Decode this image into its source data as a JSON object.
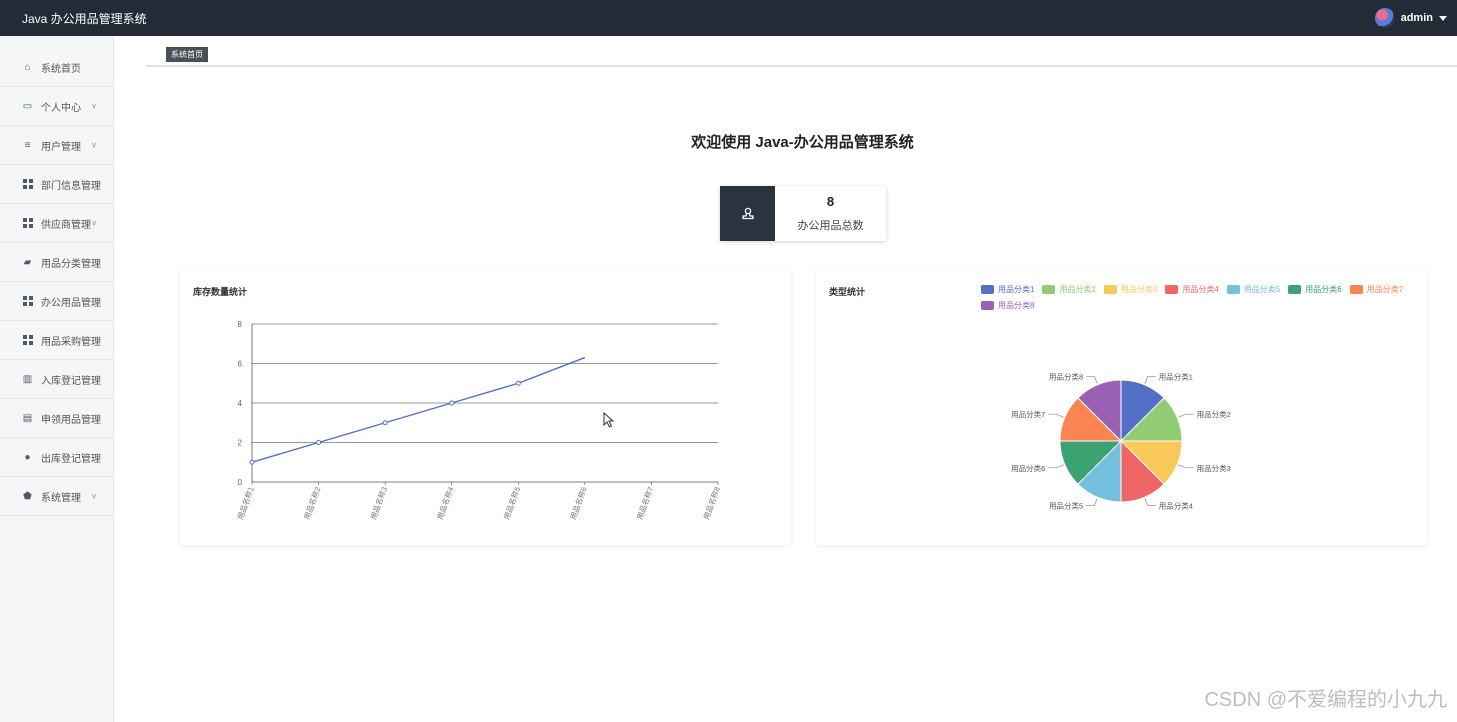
{
  "app": {
    "title": "Java 办公用品管理系统"
  },
  "user": {
    "name": "admin"
  },
  "sidebar": {
    "items": [
      {
        "label": "系统首页",
        "icon": "home-icon",
        "has_children": false
      },
      {
        "label": "个人中心",
        "icon": "profile-icon",
        "has_children": true
      },
      {
        "label": "用户管理",
        "icon": "filter-icon",
        "has_children": true
      },
      {
        "label": "部门信息管理",
        "icon": "grid-icon",
        "has_children": false
      },
      {
        "label": "供应商管理",
        "icon": "grid-icon",
        "has_children": true
      },
      {
        "label": "用品分类管理",
        "icon": "category-icon",
        "has_children": false
      },
      {
        "label": "办公用品管理",
        "icon": "grid-icon",
        "has_children": false
      },
      {
        "label": "用品采购管理",
        "icon": "grid-icon",
        "has_children": false
      },
      {
        "label": "入库登记管理",
        "icon": "barcode-icon",
        "has_children": false
      },
      {
        "label": "申领用品管理",
        "icon": "document-icon",
        "has_children": false
      },
      {
        "label": "出库登记管理",
        "icon": "user-icon",
        "has_children": false
      },
      {
        "label": "系统管理",
        "icon": "shield-icon",
        "has_children": true
      }
    ]
  },
  "breadcrumb": {
    "current": "系统首页"
  },
  "main": {
    "welcome": "欢迎使用 Java-办公用品管理系统",
    "stat": {
      "value": "8",
      "label": "办公用品总数",
      "icon": "stamp-icon"
    }
  },
  "line_panel": {
    "title": "库存数量统计"
  },
  "pie_panel": {
    "title": "类型统计"
  },
  "chart_data": [
    {
      "type": "line",
      "title": "库存数量统计",
      "categories": [
        "用品名称1",
        "用品名称2",
        "用品名称3",
        "用品名称4",
        "用品名称5",
        "用品名称6",
        "用品名称7",
        "用品名称8"
      ],
      "series": [
        {
          "values": [
            1,
            2,
            3,
            4,
            5,
            6.3
          ],
          "color": "#5470c6"
        }
      ],
      "ylim": [
        0,
        8
      ],
      "yticks": [
        0,
        2,
        4,
        6,
        8
      ],
      "grid": true
    },
    {
      "type": "pie",
      "title": "类型统计",
      "legend_position": "top",
      "slices": [
        {
          "label": "用品分类1",
          "value": 1,
          "color": "#5470c6"
        },
        {
          "label": "用品分类2",
          "value": 1,
          "color": "#91cc75"
        },
        {
          "label": "用品分类3",
          "value": 1,
          "color": "#fac858"
        },
        {
          "label": "用品分类4",
          "value": 1,
          "color": "#ee6666"
        },
        {
          "label": "用品分类5",
          "value": 1,
          "color": "#73c0de"
        },
        {
          "label": "用品分类6",
          "value": 1,
          "color": "#3ba272"
        },
        {
          "label": "用品分类7",
          "value": 1,
          "color": "#fc8452"
        },
        {
          "label": "用品分类8",
          "value": 1,
          "color": "#9a60b4"
        }
      ]
    }
  ],
  "watermark": "CSDN @不爱编程的小九九"
}
